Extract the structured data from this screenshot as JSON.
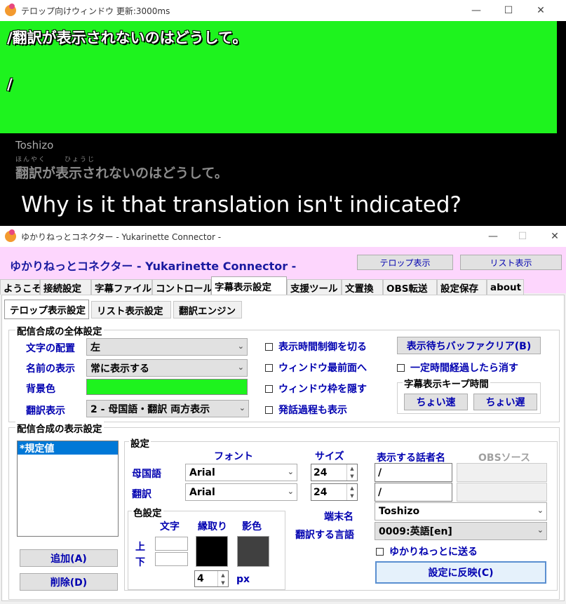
{
  "telop_window": {
    "title": "テロップ向けウィンドウ  更新:3000ms",
    "line1": "/翻訳が表示されないのはどうして。",
    "line2": "/",
    "speaker": "Toshizo",
    "ruby1": "ほんやく",
    "ruby2": "ひょうじ",
    "subtitle_text": "翻訳が表示されないのはどうして。",
    "subtitle_translation": "Why is it that translation isn't indicated?",
    "background_color": "#1ef31e"
  },
  "connector": {
    "title": "ゆかりねっとコネクター - Yukarinette Connector -",
    "brand": "ゆかりねっとコネクター  - Yukarinette Connector -",
    "buttons": {
      "telop_show": "テロップ表示",
      "list_show": "リスト表示"
    },
    "main_tabs": [
      "ようこそ",
      "接続設定",
      "字幕ファイル",
      "コントロール",
      "字幕表示設定",
      "支援ツール",
      "文置換",
      "OBS転送",
      "設定保存",
      "about"
    ],
    "sub_tabs": [
      "テロップ表示設定",
      "リスト表示設定",
      "翻訳エンジン"
    ],
    "overall": {
      "group_title": "配信合成の全体設定",
      "align_label": "文字の配置",
      "align_value": "左",
      "name_label": "名前の表示",
      "name_value": "常に表示する",
      "bg_label": "背景色",
      "trans_label": "翻訳表示",
      "trans_value": "2 - 母国語・翻訳  両方表示",
      "checks": [
        "表示時間制御を切る",
        "ウィンドウ最前面へ",
        "ウィンドウ枠を隠す",
        "発話過程も表示"
      ],
      "buffer_clear": "表示待ちバッファクリア(B)",
      "auto_hide": "一定時間経過したら消す",
      "keep_title": "字幕表示キープ時間",
      "faster": "ちょい速",
      "slower": "ちょい遅"
    },
    "display": {
      "group_title": "配信合成の表示設定",
      "list_items": [
        "*規定値"
      ],
      "add": "追加(A)",
      "delete": "削除(D)",
      "settings_title": "設定",
      "font_header": "フォント",
      "size_header": "サイズ",
      "speaker_header": "表示する話者名",
      "obs_header": "OBSソース",
      "native_label": "母国語",
      "trans_label": "翻訳",
      "native_font": "Arial",
      "trans_font": "Arial",
      "native_size": "24",
      "trans_size": "24",
      "native_speaker": "/",
      "trans_speaker": "/",
      "color_title": "色設定",
      "col_text": "文字",
      "col_edge": "縁取り",
      "col_shadow": "影色",
      "row_top": "上",
      "row_bottom": "下",
      "edge_width": "4",
      "px": "px",
      "terminal_label": "端末名",
      "terminal_value": "Toshizo",
      "lang_label": "翻訳する言語",
      "lang_value": "0009:英語[en]",
      "send_check": "ゆかりねっとに送る",
      "apply": "設定に反映(C)"
    }
  }
}
